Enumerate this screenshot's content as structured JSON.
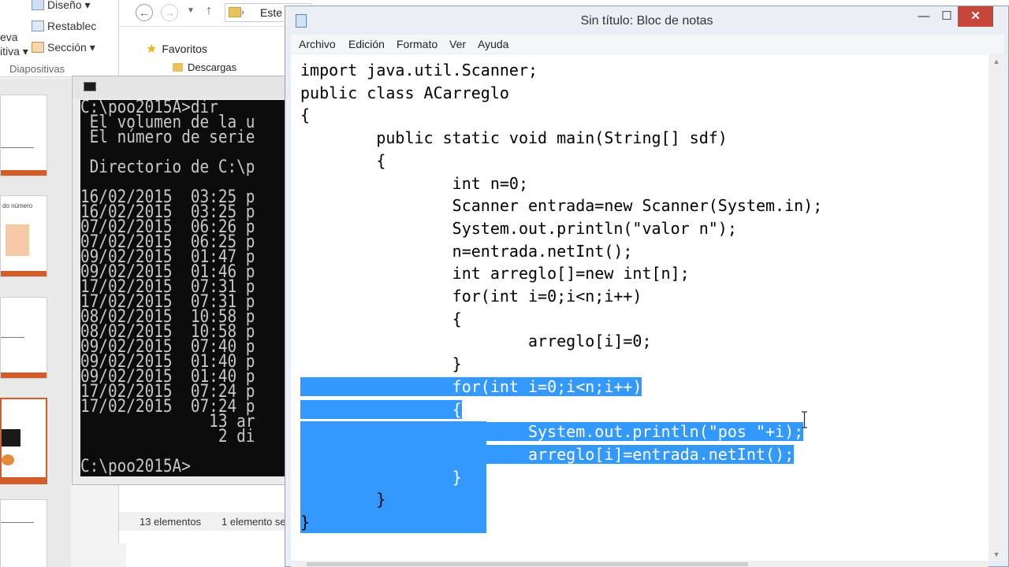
{
  "powerpoint": {
    "ribbon": {
      "design_label": "Diseño",
      "reset_label": "Restablec",
      "section_label": "Sección",
      "left_partial_1": "eva",
      "left_partial_2": "itiva",
      "group_label": "Diapositivas"
    },
    "thumbnail_text": "do número",
    "accent_color": "#d35d2a"
  },
  "explorer": {
    "address_text": "Este e",
    "favorites_label": "Favoritos",
    "downloads_label": "Descargas",
    "status_items": "13 elementos",
    "status_selected": "1 elemento se"
  },
  "console": {
    "lines": [
      "C:\\poo2015A>dir",
      " El volumen de la u",
      " El número de serie",
      "",
      " Directorio de C:\\p",
      "",
      "16/02/2015  03:25 p",
      "16/02/2015  03:25 p",
      "07/02/2015  06:26 p",
      "07/02/2015  06:25 p",
      "09/02/2015  01:47 p",
      "09/02/2015  01:46 p",
      "17/02/2015  07:31 p",
      "17/02/2015  07:31 p",
      "08/02/2015  10:58 p",
      "08/02/2015  10:58 p",
      "09/02/2015  07:40 p",
      "09/02/2015  01:40 p",
      "09/02/2015  01:40 p",
      "17/02/2015  07:24 p",
      "17/02/2015  07:24 p",
      "              13 ar",
      "               2 di",
      "",
      "C:\\poo2015A>"
    ]
  },
  "notepad": {
    "title": "Sin título: Bloc de notas",
    "window_controls": {
      "minimize": "—",
      "maximize": "☐",
      "close": "✕"
    },
    "menu": [
      "Archivo",
      "Edición",
      "Formato",
      "Ver",
      "Ayuda"
    ],
    "selection_color": "#3399ff",
    "code_lines": [
      {
        "text": "import java.util.Scanner;",
        "selected": false
      },
      {
        "text": "public class ACarreglo",
        "selected": false
      },
      {
        "text": "{",
        "selected": false
      },
      {
        "text": "        public static void main(String[] sdf)",
        "selected": false
      },
      {
        "text": "        {",
        "selected": false
      },
      {
        "text": "                int n=0;",
        "selected": false
      },
      {
        "text": "                Scanner entrada=new Scanner(System.in);",
        "selected": false
      },
      {
        "text": "                System.out.println(\"valor n\");",
        "selected": false
      },
      {
        "text": "                n=entrada.netInt();",
        "selected": false
      },
      {
        "text": "                int arreglo[]=new int[n];",
        "selected": false
      },
      {
        "text": "                for(int i=0;i<n;i++)",
        "selected": false
      },
      {
        "text": "                {",
        "selected": false
      },
      {
        "text": "                        arreglo[i]=0;",
        "selected": false
      },
      {
        "text": "                }",
        "selected": false
      },
      {
        "text": "                for(int i=0;i<n;i++)",
        "selected": true
      },
      {
        "text": "                {",
        "selected": true
      },
      {
        "text": "                        System.out.println(\"pos \"+i);",
        "selected": true
      },
      {
        "text": "                        arreglo[i]=entrada.netInt();",
        "selected": true
      },
      {
        "text": "                }",
        "selected": true
      },
      {
        "text": "        }",
        "selected": false
      },
      {
        "text": "}",
        "selected": false
      }
    ]
  }
}
